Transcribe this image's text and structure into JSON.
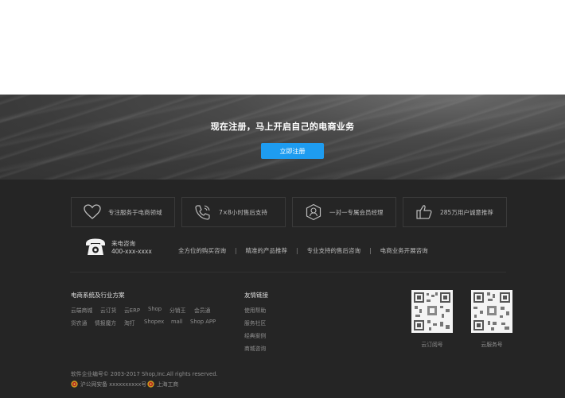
{
  "banner": {
    "title": "现在注册，马上开启自己的电商业务",
    "button_label": "立即注册"
  },
  "features": [
    {
      "icon": "heart-icon",
      "label": "专注服务于电商领域"
    },
    {
      "icon": "phone-support-icon",
      "label": "7×8小时售后支持"
    },
    {
      "icon": "user-badge-icon",
      "label": "一对一专属会员经理"
    },
    {
      "icon": "thumbs-up-icon",
      "label": "285万用户诚意推荐"
    }
  ],
  "hotline": {
    "label": "来电咨询",
    "number": "400-xxx-xxxx"
  },
  "service_links": [
    "全方位的购买咨询",
    "精准的产品推荐",
    "专业支持的售后咨询",
    "电商业务开展咨询"
  ],
  "solutions": {
    "title": "电商系统及行业方案",
    "row1": [
      "云端商城",
      "云订货",
      "云ERP",
      "Shop",
      "分销王",
      "会员通"
    ],
    "row2": [
      "货农通",
      "情报魔方",
      "淘打",
      "Shopex",
      "mall",
      "Shop APP"
    ]
  },
  "friend_links": {
    "title": "友情链接",
    "items": [
      "使用帮助",
      "服务社区",
      "经典案例",
      "商城咨询"
    ]
  },
  "qrcodes": [
    {
      "caption": "云订阅号"
    },
    {
      "caption": "云服务号"
    }
  ],
  "copyright": "软件企业编号© 2003-2017 Shop,Inc.All rights reserved.",
  "badges": [
    {
      "label": "沪公网安备 xxxxxxxxxx号"
    },
    {
      "label": "上海工商"
    }
  ],
  "colors": {
    "accent": "#1e9cf0",
    "footer_bg": "#252525"
  }
}
